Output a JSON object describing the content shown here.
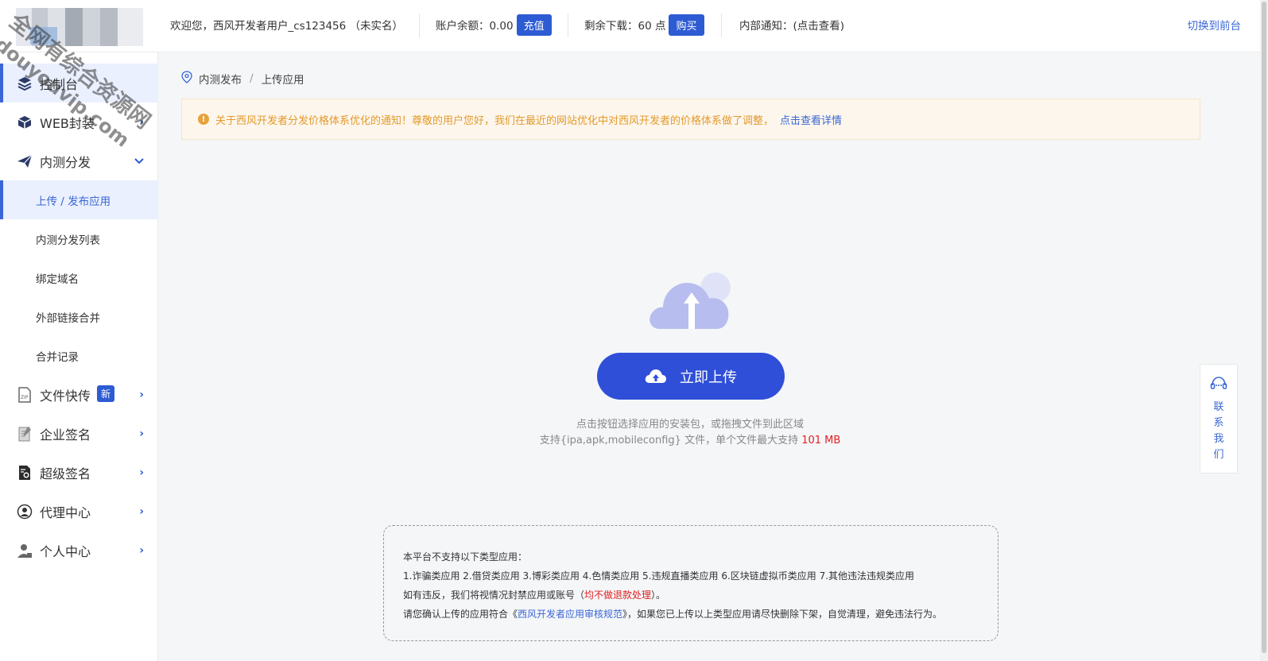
{
  "header": {
    "welcome": "欢迎您，西风开发者用户_cs123456 （未实名）",
    "balance_label": "账户余额：0.00",
    "recharge_button": "充值",
    "downloads_label": "剩余下载：60 点",
    "buy_button": "购买",
    "internal_notice": "内部通知：(点击查看)",
    "switch_frontend": "切换到前台"
  },
  "watermark": {
    "line1": "全网有综合资源网",
    "line2": "douyouvip.com"
  },
  "sidebar": {
    "items": [
      {
        "label": "控制台",
        "icon": "layers-icon",
        "active": true
      },
      {
        "label": "WEB封装",
        "icon": "box-icon",
        "arrow": "›"
      },
      {
        "label": "内测分发",
        "icon": "paper-plane-icon",
        "arrow": "⌄"
      },
      {
        "label": "文件快传",
        "icon": "file-icon",
        "badge": "新",
        "arrow": "›"
      },
      {
        "label": "企业签名",
        "icon": "document-icon",
        "arrow": "›"
      },
      {
        "label": "超级签名",
        "icon": "certificate-icon",
        "arrow": "›"
      },
      {
        "label": "代理中心",
        "icon": "agent-icon",
        "arrow": "›"
      },
      {
        "label": "个人中心",
        "icon": "user-icon",
        "arrow": "›"
      }
    ],
    "sub_items": [
      {
        "label": "上传 / 发布应用",
        "active": true
      },
      {
        "label": "内测分发列表"
      },
      {
        "label": "绑定域名"
      },
      {
        "label": "外部链接合并"
      },
      {
        "label": "合并记录"
      }
    ]
  },
  "breadcrumb": {
    "icon": "location-pin-icon",
    "parent": "内测发布",
    "separator": "/",
    "current": "上传应用"
  },
  "notice": {
    "text": "关于西风开发者分发价格体系优化的通知！尊敬的用户您好，我们在最近的网站优化中对西风开发者的价格体系做了调整，",
    "link": "点击查看详情"
  },
  "upload": {
    "button_label": "立即上传",
    "hint_line1": "点击按钮选择应用的安装包，或拖拽文件到此区域",
    "hint_line2_prefix": "支持{ipa,apk,mobileconfig} 文件，单个文件最大支持",
    "max_size": "101 MB"
  },
  "rules": {
    "line1": "本平台不支持以下类型应用：",
    "line2": "1.诈骗类应用 2.借贷类应用 3.博彩类应用 4.色情类应用 5.违规直播类应用 6.区块链虚拟币类应用 7.其他违法违规类应用",
    "line3_prefix": "如有违反，我们将视情况封禁应用或账号（",
    "line3_red": "均不做退款处理",
    "line3_suffix": "）。",
    "line4_prefix": "请您确认上传的应用符合《",
    "line4_link": "西风开发者应用审核规范",
    "line4_suffix": "》，如果您已上传以上类型应用请尽快删除下架，自觉清理，避免违法行为。"
  },
  "contact": {
    "label": "联系我们",
    "icon": "headset-icon"
  },
  "colors": {
    "primary": "#2f4fd8",
    "link": "#3a67d6",
    "warning": "#e6a23c",
    "danger": "#e02020",
    "active_bg": "#eaf0fe"
  }
}
